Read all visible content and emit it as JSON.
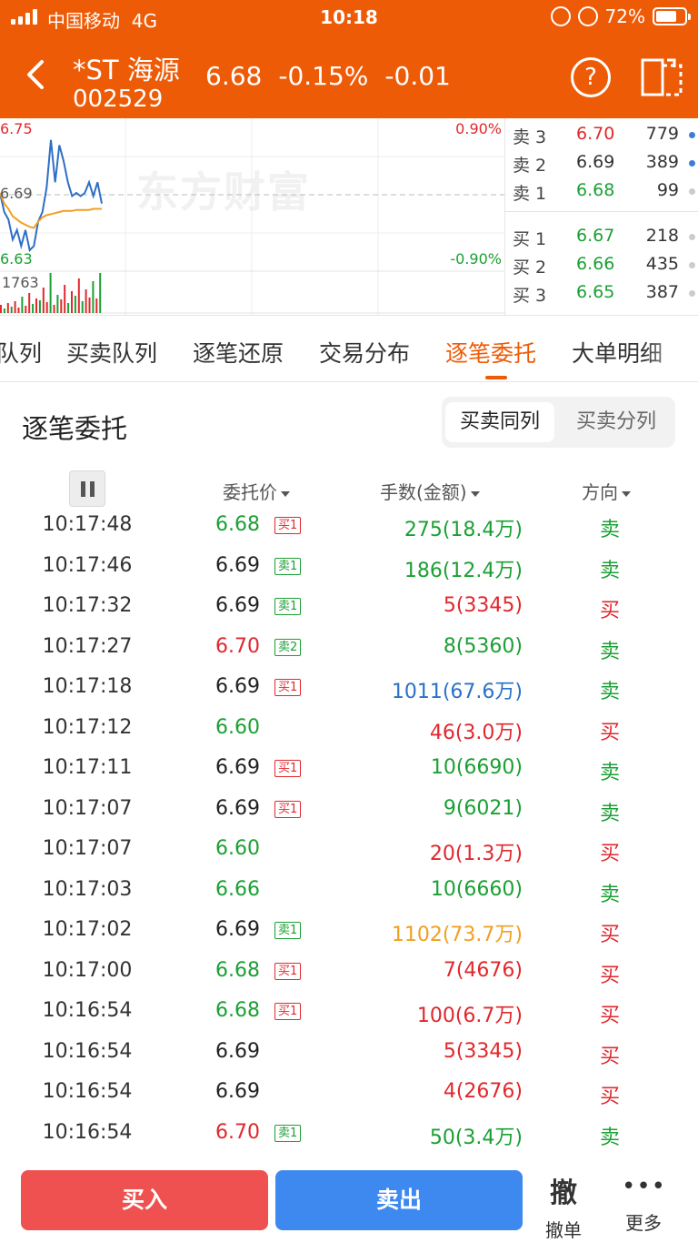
{
  "status_bar": {
    "carrier": "中国移动",
    "network": "4G",
    "time": "10:18",
    "battery": "72%"
  },
  "header": {
    "name": "*ST 海源",
    "code": "002529",
    "price": "6.68",
    "change_pct": "-0.15%",
    "change": "-0.01",
    "help": "?"
  },
  "chart": {
    "high": "6.75",
    "mid": "6.69",
    "low": "6.63",
    "pct_high": "0.90%",
    "pct_low": "-0.90%",
    "volume": "1763",
    "watermark": "东方财富"
  },
  "chart_data": {
    "type": "line",
    "ylim": [
      6.63,
      6.75
    ],
    "series": [
      {
        "values": [
          6.69,
          6.672,
          6.665,
          6.646,
          6.655,
          6.64,
          6.655,
          6.636,
          6.64,
          6.663,
          6.672,
          6.695,
          6.74,
          6.7,
          6.735,
          6.72,
          6.7,
          6.687,
          6.69,
          6.687,
          6.69,
          6.7,
          6.687,
          6.7,
          6.68
        ]
      },
      {
        "values": [
          6.69,
          6.68,
          6.675,
          6.668,
          6.665,
          6.662,
          6.66,
          6.658,
          6.657,
          6.663,
          6.667,
          6.669,
          6.67,
          6.671,
          6.672,
          6.673,
          6.673,
          6.673,
          6.674,
          6.674,
          6.674,
          6.674,
          6.675,
          6.675,
          6.675
        ]
      }
    ],
    "volume_bars": [
      9,
      5,
      11,
      7,
      13,
      6,
      18,
      8,
      22,
      10,
      16,
      14,
      28,
      12,
      44,
      9,
      20,
      15,
      31,
      11,
      24,
      19,
      38,
      13,
      26,
      17,
      35,
      16,
      44
    ],
    "volume_colors": [
      "red",
      "green",
      "red",
      "green",
      "red",
      "red",
      "green",
      "red",
      "red",
      "green",
      "red",
      "green",
      "red",
      "red",
      "green",
      "red",
      "green",
      "red",
      "red",
      "green",
      "red",
      "green",
      "red",
      "green",
      "red",
      "red",
      "green",
      "red",
      "green"
    ]
  },
  "depth": {
    "asks": [
      {
        "label": "卖 3",
        "price": "6.70",
        "vol": "779",
        "color": "#e0282d",
        "dot": "#3d7dd8"
      },
      {
        "label": "卖 2",
        "price": "6.69",
        "vol": "389",
        "color": "#333333",
        "dot": "#3d7dd8"
      },
      {
        "label": "卖 1",
        "price": "6.68",
        "vol": "99",
        "color": "#1ba034",
        "dot": "#cccccc"
      }
    ],
    "bids": [
      {
        "label": "买 1",
        "price": "6.67",
        "vol": "218",
        "color": "#1ba034",
        "dot": "#cccccc"
      },
      {
        "label": "买 2",
        "price": "6.66",
        "vol": "435",
        "color": "#1ba034",
        "dot": "#cccccc"
      },
      {
        "label": "买 3",
        "price": "6.65",
        "vol": "387",
        "color": "#1ba034",
        "dot": "#cccccc"
      }
    ]
  },
  "tabs": [
    {
      "label": "队列",
      "active": false
    },
    {
      "label": "买卖队列",
      "active": false
    },
    {
      "label": "逐笔还原",
      "active": false
    },
    {
      "label": "交易分布",
      "active": false
    },
    {
      "label": "逐笔委托",
      "active": true
    },
    {
      "label": "大单明细",
      "active": false
    }
  ],
  "section": {
    "title": "逐笔委托",
    "seg_on": "买卖同列",
    "seg_off": "买卖分列",
    "col_price": "委托价",
    "col_amount": "手数(金额)",
    "col_direction": "方向"
  },
  "rows": [
    {
      "time": "10:17:48",
      "price": "6.68",
      "price_color": "#1ba034",
      "tag": "买1",
      "tag_color": "#e0282d",
      "amount": "275(18.4万)",
      "amount_color": "#1ba034",
      "dir": "卖",
      "dir_color": "#1ba034"
    },
    {
      "time": "10:17:46",
      "price": "6.69",
      "price_color": "#222222",
      "tag": "卖1",
      "tag_color": "#1ba034",
      "amount": "186(12.4万)",
      "amount_color": "#1ba034",
      "dir": "卖",
      "dir_color": "#1ba034"
    },
    {
      "time": "10:17:32",
      "price": "6.69",
      "price_color": "#222222",
      "tag": "卖1",
      "tag_color": "#1ba034",
      "amount": "5(3345)",
      "amount_color": "#e0282d",
      "dir": "买",
      "dir_color": "#e0282d"
    },
    {
      "time": "10:17:27",
      "price": "6.70",
      "price_color": "#e0282d",
      "tag": "卖2",
      "tag_color": "#1ba034",
      "amount": "8(5360)",
      "amount_color": "#1ba034",
      "dir": "卖",
      "dir_color": "#1ba034"
    },
    {
      "time": "10:17:18",
      "price": "6.69",
      "price_color": "#222222",
      "tag": "买1",
      "tag_color": "#e0282d",
      "amount": "1011(67.6万)",
      "amount_color": "#2a71c8",
      "dir": "卖",
      "dir_color": "#1ba034"
    },
    {
      "time": "10:17:12",
      "price": "6.60",
      "price_color": "#1ba034",
      "tag": "",
      "tag_color": "",
      "amount": "46(3.0万)",
      "amount_color": "#e0282d",
      "dir": "买",
      "dir_color": "#e0282d"
    },
    {
      "time": "10:17:11",
      "price": "6.69",
      "price_color": "#222222",
      "tag": "买1",
      "tag_color": "#e0282d",
      "amount": "10(6690)",
      "amount_color": "#1ba034",
      "dir": "卖",
      "dir_color": "#1ba034"
    },
    {
      "time": "10:17:07",
      "price": "6.69",
      "price_color": "#222222",
      "tag": "买1",
      "tag_color": "#e0282d",
      "amount": "9(6021)",
      "amount_color": "#1ba034",
      "dir": "卖",
      "dir_color": "#1ba034"
    },
    {
      "time": "10:17:07",
      "price": "6.60",
      "price_color": "#1ba034",
      "tag": "",
      "tag_color": "",
      "amount": "20(1.3万)",
      "amount_color": "#e0282d",
      "dir": "买",
      "dir_color": "#e0282d"
    },
    {
      "time": "10:17:03",
      "price": "6.66",
      "price_color": "#1ba034",
      "tag": "",
      "tag_color": "",
      "amount": "10(6660)",
      "amount_color": "#1ba034",
      "dir": "卖",
      "dir_color": "#1ba034"
    },
    {
      "time": "10:17:02",
      "price": "6.69",
      "price_color": "#222222",
      "tag": "卖1",
      "tag_color": "#1ba034",
      "amount": "1102(73.7万)",
      "amount_color": "#f0a020",
      "dir": "买",
      "dir_color": "#e0282d"
    },
    {
      "time": "10:17:00",
      "price": "6.68",
      "price_color": "#1ba034",
      "tag": "买1",
      "tag_color": "#e0282d",
      "amount": "7(4676)",
      "amount_color": "#e0282d",
      "dir": "买",
      "dir_color": "#e0282d"
    },
    {
      "time": "10:16:54",
      "price": "6.68",
      "price_color": "#1ba034",
      "tag": "买1",
      "tag_color": "#e0282d",
      "amount": "100(6.7万)",
      "amount_color": "#e0282d",
      "dir": "买",
      "dir_color": "#e0282d"
    },
    {
      "time": "10:16:54",
      "price": "6.69",
      "price_color": "#222222",
      "tag": "",
      "tag_color": "",
      "amount": "5(3345)",
      "amount_color": "#e0282d",
      "dir": "买",
      "dir_color": "#e0282d"
    },
    {
      "time": "10:16:54",
      "price": "6.69",
      "price_color": "#222222",
      "tag": "",
      "tag_color": "",
      "amount": "4(2676)",
      "amount_color": "#e0282d",
      "dir": "买",
      "dir_color": "#e0282d"
    },
    {
      "time": "10:16:54",
      "price": "6.70",
      "price_color": "#e0282d",
      "tag": "卖1",
      "tag_color": "#1ba034",
      "amount": "50(3.4万)",
      "amount_color": "#1ba034",
      "dir": "卖",
      "dir_color": "#1ba034"
    }
  ],
  "bottom": {
    "buy": "买入",
    "sell": "卖出",
    "cancel_big": "撤",
    "cancel": "撤单",
    "more_dots": "•••",
    "more": "更多"
  }
}
